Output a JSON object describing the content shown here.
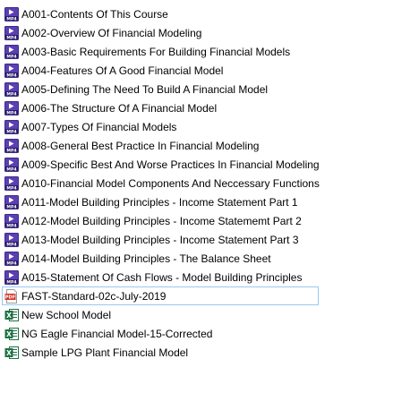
{
  "colors": {
    "mp4_icon": "#5b3fb3",
    "pdf_icon": "#d0342c",
    "excel_icon": "#1e7145",
    "focus_border": "#99c9f3"
  },
  "files": [
    {
      "name": "A001-Contents Of This Course",
      "icon": "mp4-icon"
    },
    {
      "name": "A002-Overview Of Financial Modeling",
      "icon": "mp4-icon"
    },
    {
      "name": "A003-Basic Requirements For Building Financial Models",
      "icon": "mp4-icon"
    },
    {
      "name": "A004-Features Of A Good Financial Model",
      "icon": "mp4-icon"
    },
    {
      "name": "A005-Defining The Need To Build A Financial Model",
      "icon": "mp4-icon"
    },
    {
      "name": "A006-The Structure Of A Financial Model",
      "icon": "mp4-icon"
    },
    {
      "name": "A007-Types Of Financial Models",
      "icon": "mp4-icon"
    },
    {
      "name": "A008-General Best Practice In Financial Modeling",
      "icon": "mp4-icon"
    },
    {
      "name": "A009-Specific Best And Worse Practices In Financial Modeling",
      "icon": "mp4-icon"
    },
    {
      "name": "A010-Financial Model Components And Neccessary Functions",
      "icon": "mp4-icon"
    },
    {
      "name": "A011-Model Building Principles - Income Statement Part 1",
      "icon": "mp4-icon"
    },
    {
      "name": "A012-Model Building Principles - Income Statememt Part 2",
      "icon": "mp4-icon"
    },
    {
      "name": "A013-Model Building Principles - Income Statement Part 3",
      "icon": "mp4-icon"
    },
    {
      "name": "A014-Model Building Principles - The Balance Sheet",
      "icon": "mp4-icon"
    },
    {
      "name": "A015-Statement Of Cash Flows - Model Building Principles",
      "icon": "mp4-icon"
    },
    {
      "name": "FAST-Standard-02c-July-2019",
      "icon": "pdf-icon",
      "focused": true
    },
    {
      "name": "New School Model",
      "icon": "excel-icon"
    },
    {
      "name": "NG Eagle Financial Model-15-Corrected",
      "icon": "excel-icon"
    },
    {
      "name": "Sample LPG Plant Financial Model",
      "icon": "excel-icon"
    }
  ]
}
